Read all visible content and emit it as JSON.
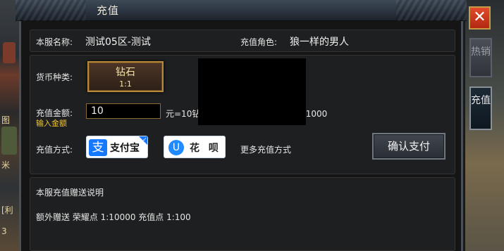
{
  "window": {
    "title": "充值"
  },
  "side_texts": [
    "图",
    "米",
    "[利",
    "3"
  ],
  "server_row": {
    "server_label": "本服名称:",
    "server_value": "测试05区-测试",
    "role_label": "充值角色:",
    "role_value": "狼一样的男人"
  },
  "currency": {
    "label": "货币种类:",
    "option_name": "钻石",
    "option_ratio": "1:1"
  },
  "amount": {
    "label": "充值金额:",
    "hint": "输入金额",
    "value": "10",
    "conversion_text": "元=10钻石   荣耀点*100000   充值点*1000"
  },
  "payment": {
    "label": "充值方式:",
    "alipay_label": "支付宝",
    "alipay_icon_char": "支",
    "huabei_label": "花 呗",
    "huabei_icon_char": "U",
    "more_label": "更多充值方式",
    "confirm_label": "确认支付"
  },
  "bonus": {
    "title": "本服充值赠送说明",
    "detail": "额外赠送   荣耀点 1:10000   充值点 1:100"
  },
  "sidebar": {
    "close_char": "✕",
    "tab_hot": "热销",
    "tab_recharge": "充值"
  },
  "colors": {
    "accent_gold": "#f0c630",
    "alipay_blue": "#1677ff",
    "close_red": "#c9331a"
  }
}
